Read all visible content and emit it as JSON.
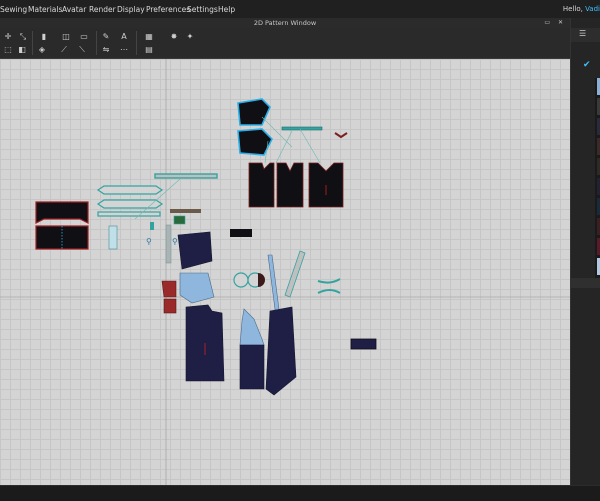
{
  "menu": {
    "items": [
      "Sewing",
      "Materials",
      "Avatar",
      "Render",
      "Display",
      "Preferences",
      "Settings",
      "Help"
    ],
    "greeting_prefix": "Hello, ",
    "user": "Vadi"
  },
  "window": {
    "title": "2D Pattern Window",
    "controls": "▭ ✕"
  },
  "toolbar": {
    "row1": [
      "transform-pattern-icon",
      "edit-pattern-icon",
      "segment-icon",
      "rectangle-icon",
      "circle-icon",
      "polygon-icon",
      "internal-line-icon",
      "text-edit-icon",
      "text-icon",
      "dart-icon",
      "grade-icon",
      "pin-icon",
      "magic-icon"
    ],
    "row2": [
      "fold-icon",
      "trace-icon",
      "symmetric-icon",
      "segment-sewing-icon",
      "free-sewing-icon",
      "measure-icon",
      "seam-allowance-icon",
      "puckering-icon"
    ]
  },
  "panel": {
    "tabs_icon": "list-icon",
    "check_icon": "checkmark-icon",
    "accent": "#3ec1ff"
  },
  "colors": {
    "canvas": "#d4d4d4",
    "navy_fabric": "#1f1f45",
    "black_fabric": "#0f0f14",
    "light_blue_fabric": "#8fb6dc",
    "red_fabric": "#9a2a2a",
    "selected_outline": "#2ab0e8",
    "sewing_line": "#34a3a0"
  }
}
